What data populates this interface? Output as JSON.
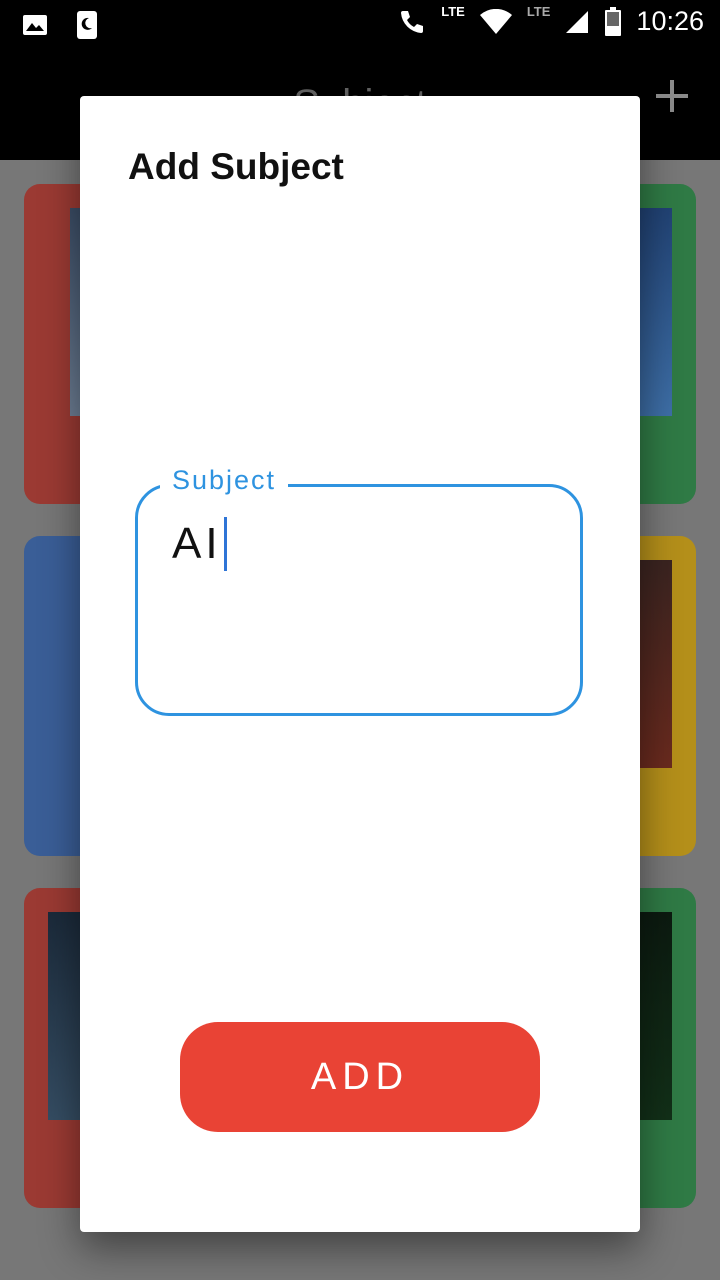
{
  "status_bar": {
    "time": "10:26",
    "network_label_1": "LTE",
    "network_label_2": "LTE",
    "icons": [
      "gallery-icon",
      "moon-notification-icon",
      "wifi-call-icon",
      "wifi-icon",
      "cell-signal-icon",
      "battery-icon"
    ]
  },
  "app_bar": {
    "title": "Subject",
    "add_icon": "plus-icon"
  },
  "dialog": {
    "title": "Add Subject",
    "subject_field": {
      "label": "Subject",
      "value": "AI"
    },
    "add_button_label": "ADD"
  },
  "colors": {
    "accent_blue": "#2e93e0",
    "add_button_red": "#e94335",
    "card_red": "#c63a2e",
    "card_green": "#2e8b3e",
    "card_blue": "#2f5fa8",
    "card_yellow": "#d9a400"
  }
}
